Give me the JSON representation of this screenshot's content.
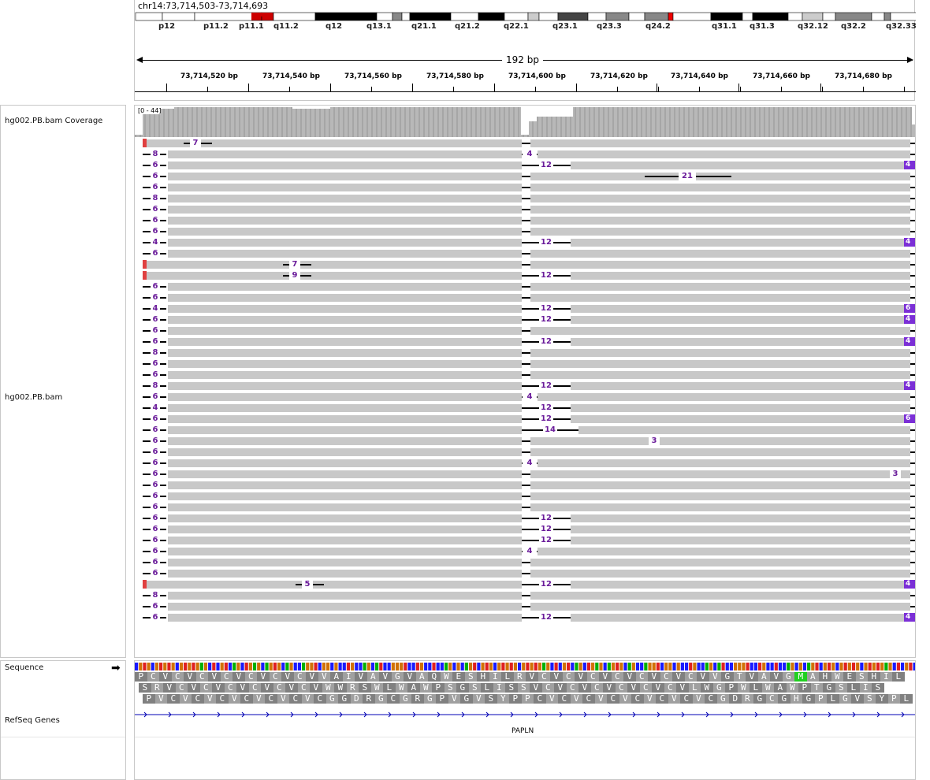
{
  "locus": "chr14:73,714,503-73,714,693",
  "ideogram": {
    "bands": [
      "p12",
      "p11.2",
      "p11.1",
      "q11.2",
      "q12",
      "q13.1",
      "q21.1",
      "q21.2",
      "q22.1",
      "q23.1",
      "q23.3",
      "q24.2",
      "q31.1",
      "q31.3",
      "q32.12",
      "q32.2",
      "q32.33"
    ]
  },
  "span_label": "192 bp",
  "ruler_ticks": [
    "73,714,520 bp",
    "73,714,540 bp",
    "73,714,560 bp",
    "73,714,580 bp",
    "73,714,600 bp",
    "73,714,620 bp",
    "73,714,640 bp",
    "73,714,660 bp",
    "73,714,680 bp"
  ],
  "tracks": {
    "coverage_label": "hg002.PB.bam Coverage",
    "coverage_range": "[0 - 44]",
    "alignment_label": "hg002.PB.bam",
    "sequence_label": "Sequence",
    "refseq_label": "RefSeq Genes"
  },
  "gene_name": "PAPLN",
  "colors": {
    "read": "#c8c8c8",
    "insertion": "#7b2fd6",
    "softclip": "#e04040",
    "coverage": "#b4b4b4",
    "gene_line": "#0000b4",
    "base_A": "#00b000",
    "base_C": "#1a1aff",
    "base_G": "#d17105",
    "base_T": "#e02020"
  },
  "rows": [
    {
      "left": "",
      "mid": "",
      "right": "",
      "left_ins": "7"
    },
    {
      "left": "8",
      "mid": "4",
      "right": ""
    },
    {
      "left": "6",
      "mid": "12",
      "right": "4"
    },
    {
      "left": "6",
      "mid": "",
      "right": "",
      "del": "21"
    },
    {
      "left": "6",
      "mid": "",
      "right": ""
    },
    {
      "left": "8",
      "mid": "",
      "right": ""
    },
    {
      "left": "6",
      "mid": "",
      "right": ""
    },
    {
      "left": "6",
      "mid": "",
      "right": ""
    },
    {
      "left": "6",
      "mid": "",
      "right": ""
    },
    {
      "left": "4",
      "mid": "12",
      "right": "4"
    },
    {
      "left": "6",
      "mid": "",
      "right": ""
    },
    {
      "left": "",
      "mid": "",
      "right": "",
      "left_ins": "7"
    },
    {
      "left": "",
      "mid": "12",
      "right": "",
      "left_ins": "9"
    },
    {
      "left": "6",
      "mid": "",
      "right": ""
    },
    {
      "left": "6",
      "mid": "",
      "right": ""
    },
    {
      "left": "4",
      "mid": "12",
      "right": "6"
    },
    {
      "left": "6",
      "mid": "12",
      "right": "4"
    },
    {
      "left": "6",
      "mid": "",
      "right": ""
    },
    {
      "left": "6",
      "mid": "12",
      "right": "4"
    },
    {
      "left": "8",
      "mid": "",
      "right": ""
    },
    {
      "left": "6",
      "mid": "",
      "right": ""
    },
    {
      "left": "6",
      "mid": "",
      "right": ""
    },
    {
      "left": "8",
      "mid": "12",
      "right": "4"
    },
    {
      "left": "6",
      "mid": "4",
      "right": ""
    },
    {
      "left": "4",
      "mid": "12",
      "right": ""
    },
    {
      "left": "6",
      "mid": "12",
      "right": "6"
    },
    {
      "left": "6",
      "mid": "14",
      "right": ""
    },
    {
      "left": "6",
      "mid": "",
      "right": "",
      "small": "3"
    },
    {
      "left": "6",
      "mid": "",
      "right": ""
    },
    {
      "left": "6",
      "mid": "4",
      "right": ""
    },
    {
      "left": "6",
      "mid": "",
      "right": "",
      "end": "3"
    },
    {
      "left": "6",
      "mid": "",
      "right": ""
    },
    {
      "left": "6",
      "mid": "",
      "right": ""
    },
    {
      "left": "6",
      "mid": "",
      "right": ""
    },
    {
      "left": "6",
      "mid": "12",
      "right": ""
    },
    {
      "left": "6",
      "mid": "12",
      "right": ""
    },
    {
      "left": "6",
      "mid": "12",
      "right": ""
    },
    {
      "left": "6",
      "mid": "4",
      "right": ""
    },
    {
      "left": "6",
      "mid": "",
      "right": ""
    },
    {
      "left": "6",
      "mid": "",
      "right": ""
    },
    {
      "left": "",
      "mid": "12",
      "right": "4",
      "left_ins": "5"
    },
    {
      "left": "8",
      "mid": "",
      "right": ""
    },
    {
      "left": "6",
      "mid": "",
      "right": ""
    },
    {
      "left": "6",
      "mid": "12",
      "right": "4"
    }
  ],
  "translation": {
    "frame1": "PCVCVCVCVCVCVCVVAIVAVGVAQWESHILRVCVCVCVCVCVCVCVVGTVAVGMAHWESHIL",
    "frame2": "SRVCVCVCVCVCVCVWWRSWLWAWPSGSLISSVCVCVCVCVCVCVLWGPWLWAWPTGSLIS",
    "frame3": "PVCVCVCVCVCVCVCGGDRGCGRGPVGVSYPPCVCVCVCVCVCVCVCGDRGCGHGPLGVSYPL"
  }
}
